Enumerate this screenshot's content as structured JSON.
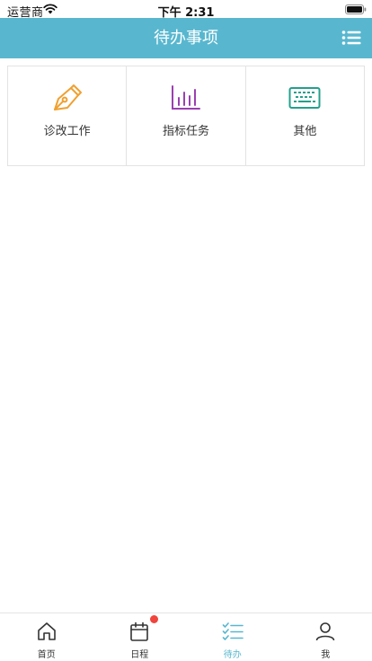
{
  "status_bar": {
    "carrier": "运营商",
    "time": "下午 2:31"
  },
  "nav": {
    "title": "待办事项"
  },
  "grid": {
    "items": [
      {
        "label": "诊改工作",
        "icon": "pen-nib-icon",
        "color": "#f0a030"
      },
      {
        "label": "指标任务",
        "icon": "bar-chart-icon",
        "color": "#9b3fb0"
      },
      {
        "label": "其他",
        "icon": "keyboard-icon",
        "color": "#23a08c"
      }
    ]
  },
  "tabs": [
    {
      "label": "首页",
      "icon": "home-icon"
    },
    {
      "label": "日程",
      "icon": "calendar-icon",
      "badge": true
    },
    {
      "label": "待办",
      "icon": "checklist-icon",
      "active": true
    },
    {
      "label": "我",
      "icon": "user-icon"
    }
  ],
  "colors": {
    "accent": "#58b7cf",
    "badge": "#f0443c"
  }
}
